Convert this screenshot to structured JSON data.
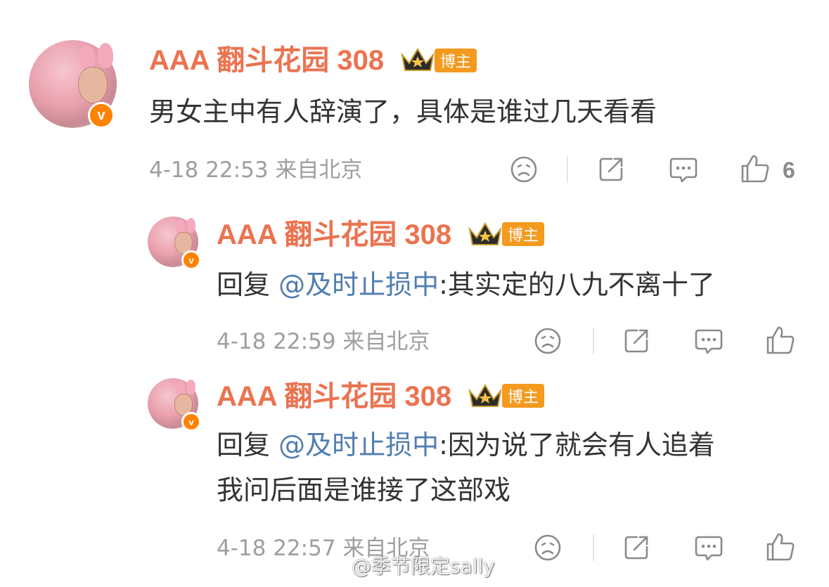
{
  "comments": [
    {
      "username": "AAA 翻斗花园 308",
      "badge": "博主",
      "text": "男女主中有人辞演了，具体是谁过几天看看",
      "time": "4-18 22:53",
      "location": "来自北京",
      "likes": "6"
    },
    {
      "username": "AAA 翻斗花园 308",
      "badge": "博主",
      "reply_prefix": "回复",
      "mention": "@及时止损中",
      "text": ":其实定的八九不离十了",
      "time": "4-18 22:59",
      "location": "来自北京"
    },
    {
      "username": "AAA 翻斗花园 308",
      "badge": "博主",
      "reply_prefix": "回复",
      "mention": "@及时止损中",
      "text": ":因为说了就会有人追着",
      "text_line2": "我问后面是谁接了这部戏",
      "time": "4-18 22:57",
      "location": "来自北京"
    }
  ],
  "watermark": "@季节限定sally",
  "colors": {
    "username": "#eb7350",
    "mention": "#507daf",
    "badge": "#f39a1f",
    "meta": "#9e9e9e",
    "verified": "#ff8200"
  },
  "icons": [
    "dislike-icon",
    "share-icon",
    "comment-icon",
    "like-icon"
  ]
}
